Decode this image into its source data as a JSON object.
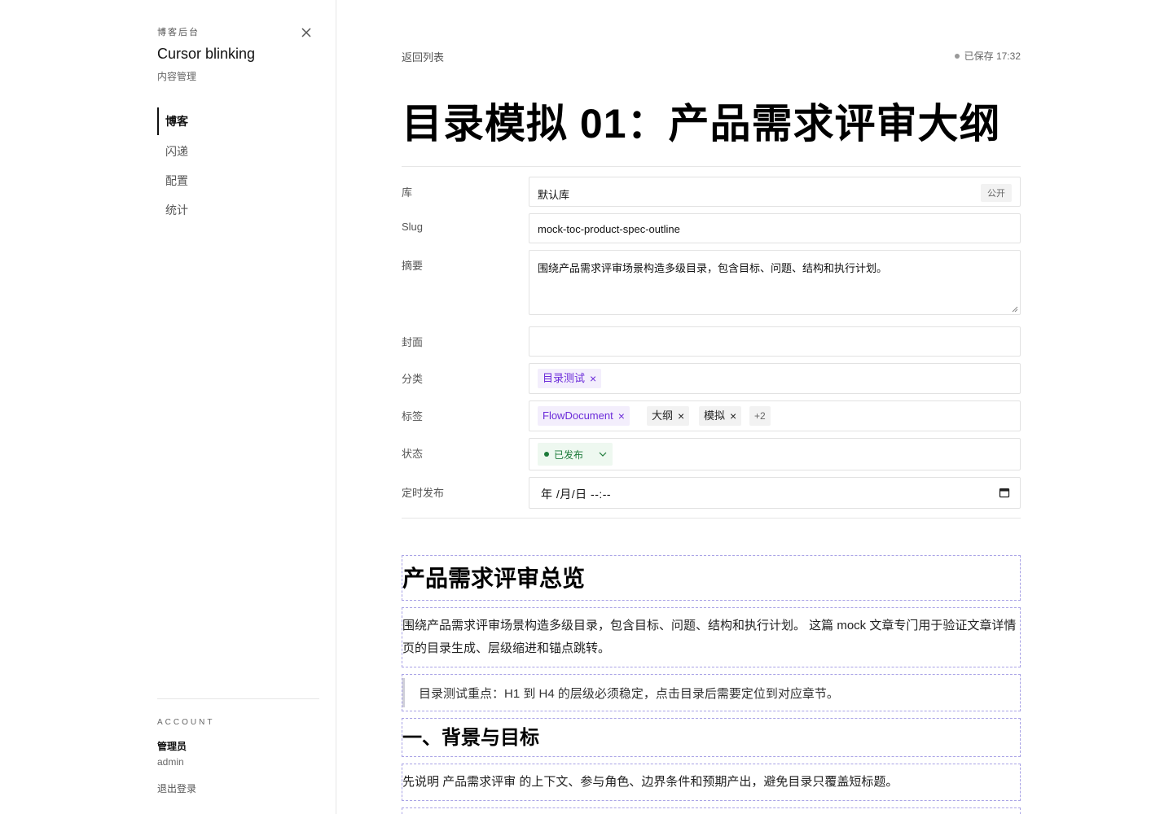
{
  "sidebar": {
    "kicker": "博客后台",
    "title": "Cursor blinking",
    "subtitle": "内容管理",
    "items": [
      {
        "label": "博客"
      },
      {
        "label": "闪递"
      },
      {
        "label": "配置"
      },
      {
        "label": "统计"
      }
    ],
    "account": {
      "label": "ACCOUNT",
      "name": "管理员",
      "id": "admin",
      "logout": "退出登录"
    }
  },
  "header": {
    "back": "返回列表",
    "saved": "已保存 17:32"
  },
  "title": "目录模拟 01：产品需求评审大纲",
  "form": {
    "library": {
      "label": "库",
      "value": "默认库",
      "badge": "公开"
    },
    "slug": {
      "label": "Slug",
      "value": "mock-toc-product-spec-outline"
    },
    "summary": {
      "label": "摘要",
      "value": "围绕产品需求评审场景构造多级目录，包含目标、问题、结构和执行计划。"
    },
    "cover": {
      "label": "封面",
      "value": ""
    },
    "category": {
      "label": "分类",
      "chips": [
        {
          "text": "目录测试"
        }
      ]
    },
    "tags": {
      "label": "标签",
      "chips": [
        {
          "text": "FlowDocument"
        },
        {
          "text": "大纲"
        },
        {
          "text": "模拟"
        }
      ],
      "more": "+2"
    },
    "status": {
      "label": "状态",
      "value": "已发布"
    },
    "schedule": {
      "label": "定时发布",
      "value": "年 /月/日 --:--"
    }
  },
  "editor": {
    "h1": "产品需求评审总览",
    "p1": "围绕产品需求评审场景构造多级目录，包含目标、问题、结构和执行计划。 这篇 mock 文章专门用于验证文章详情页的目录生成、层级缩进和锚点跳转。",
    "quote": "目录测试重点：H1 到 H4 的层级必须稳定，点击目录后需要定位到对应章节。",
    "h2": "一、背景与目标",
    "p2": "先说明 产品需求评审 的上下文、参与角色、边界条件和预期产出，避免目录只覆盖短标题。"
  },
  "colors": {
    "accent_purple": "#6b2bd9",
    "status_green": "#1c7a3a",
    "dashed_border": "#a9a3e6"
  }
}
